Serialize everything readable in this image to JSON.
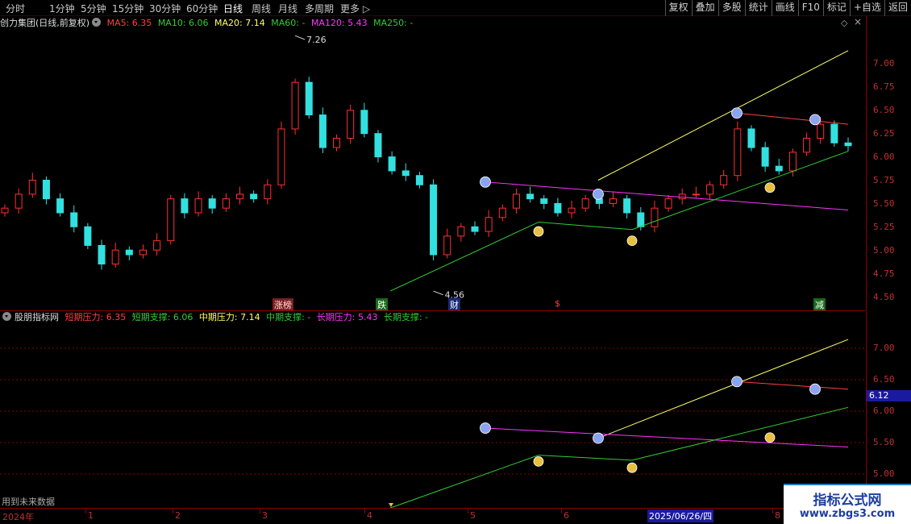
{
  "toolbar": {
    "timeframes": [
      "分时",
      "1分钟",
      "5分钟",
      "15分钟",
      "30分钟",
      "60分钟",
      "日线",
      "周线",
      "月线",
      "多周期",
      "更多 ▷"
    ],
    "active_timeframe": "日线",
    "buttons": [
      "复权",
      "叠加",
      "多股",
      "统计",
      "画线",
      "F10",
      "标记",
      "+自选",
      "返回"
    ]
  },
  "main_panel": {
    "title": "创力集团(日线,前复权)",
    "ma_items": [
      {
        "label": "MA5: 6.35",
        "color": "#ff4040"
      },
      {
        "label": "MA10: 6.06",
        "color": "#33cc33"
      },
      {
        "label": "MA20: 7.14",
        "color": "#ffff66"
      },
      {
        "label": "MA60: -",
        "color": "#33cc33"
      },
      {
        "label": "MA120: 5.43",
        "color": "#ff33ff"
      },
      {
        "label": "MA250: -",
        "color": "#33cc33"
      }
    ],
    "y_ticks": [
      "7.00",
      "6.75",
      "6.50",
      "6.25",
      "6.00",
      "5.75",
      "5.50",
      "5.25",
      "5.00",
      "4.75",
      "4.50"
    ],
    "high_label": "7.26",
    "low_label": "4.56",
    "event_tags": [
      {
        "text": "涨榜",
        "color": "#ffdddd",
        "bg": "#7a2020"
      },
      {
        "text": "跌",
        "color": "#ffffff",
        "bg": "#1a6a1a"
      },
      {
        "text": "财",
        "color": "#ffffff",
        "bg": "#1a2a7a"
      },
      {
        "text": "$",
        "color": "#ff4040",
        "bg": "transparent"
      },
      {
        "text": "减",
        "color": "#ffffff",
        "bg": "#1a6a1a"
      }
    ]
  },
  "indicator_panel": {
    "title": "股朋指标网",
    "items": [
      {
        "label": "短期压力: 6.35",
        "color": "#ff4040"
      },
      {
        "label": "短期支撑: 6.06",
        "color": "#33cc33"
      },
      {
        "label": "中期压力: 7.14",
        "color": "#ffff66"
      },
      {
        "label": "中期支撑: -",
        "color": "#33cc33"
      },
      {
        "label": "长期压力: 5.43",
        "color": "#ff33ff"
      },
      {
        "label": "长期支撑: -",
        "color": "#33cc33"
      }
    ],
    "y_ticks": [
      "7.00",
      "6.50",
      "6.00",
      "5.50",
      "5.00"
    ],
    "current_value": "6.12",
    "footer_note": "用到未来数据"
  },
  "date_axis": {
    "labels": [
      "2024年",
      "1",
      "2",
      "3",
      "4",
      "5",
      "6",
      "2025/06/26/四",
      "8"
    ]
  },
  "watermark": {
    "title": "指标公式网",
    "url": "www.zbgs3.com"
  },
  "colors": {
    "up": "#ff3030",
    "down": "#33e0e0",
    "grid": "#8b0000",
    "resistance_short": "#ff4040",
    "support_short": "#33cc33",
    "resistance_mid": "#ffff66",
    "resistance_long": "#ff33ff"
  },
  "chart_data": {
    "type": "candlestick",
    "price_range": [
      4.4,
      7.4
    ],
    "sampled_closes": [
      5.45,
      5.6,
      5.75,
      5.55,
      5.4,
      5.25,
      5.05,
      4.85,
      5.0,
      4.95,
      5.0,
      5.1,
      5.55,
      5.4,
      5.55,
      5.45,
      5.55,
      5.6,
      5.55,
      5.7,
      6.3,
      6.8,
      6.45,
      6.1,
      6.2,
      6.5,
      6.25,
      6.0,
      5.85,
      5.8,
      5.7,
      4.95,
      5.15,
      5.25,
      5.2,
      5.35,
      5.45,
      5.6,
      5.55,
      5.5,
      5.4,
      5.45,
      5.55,
      5.5,
      5.55,
      5.4,
      5.25,
      5.45,
      5.55,
      5.6,
      5.6,
      5.7,
      5.8,
      6.3,
      6.1,
      5.9,
      5.85,
      6.05,
      6.2,
      6.35,
      6.15,
      6.12
    ]
  }
}
